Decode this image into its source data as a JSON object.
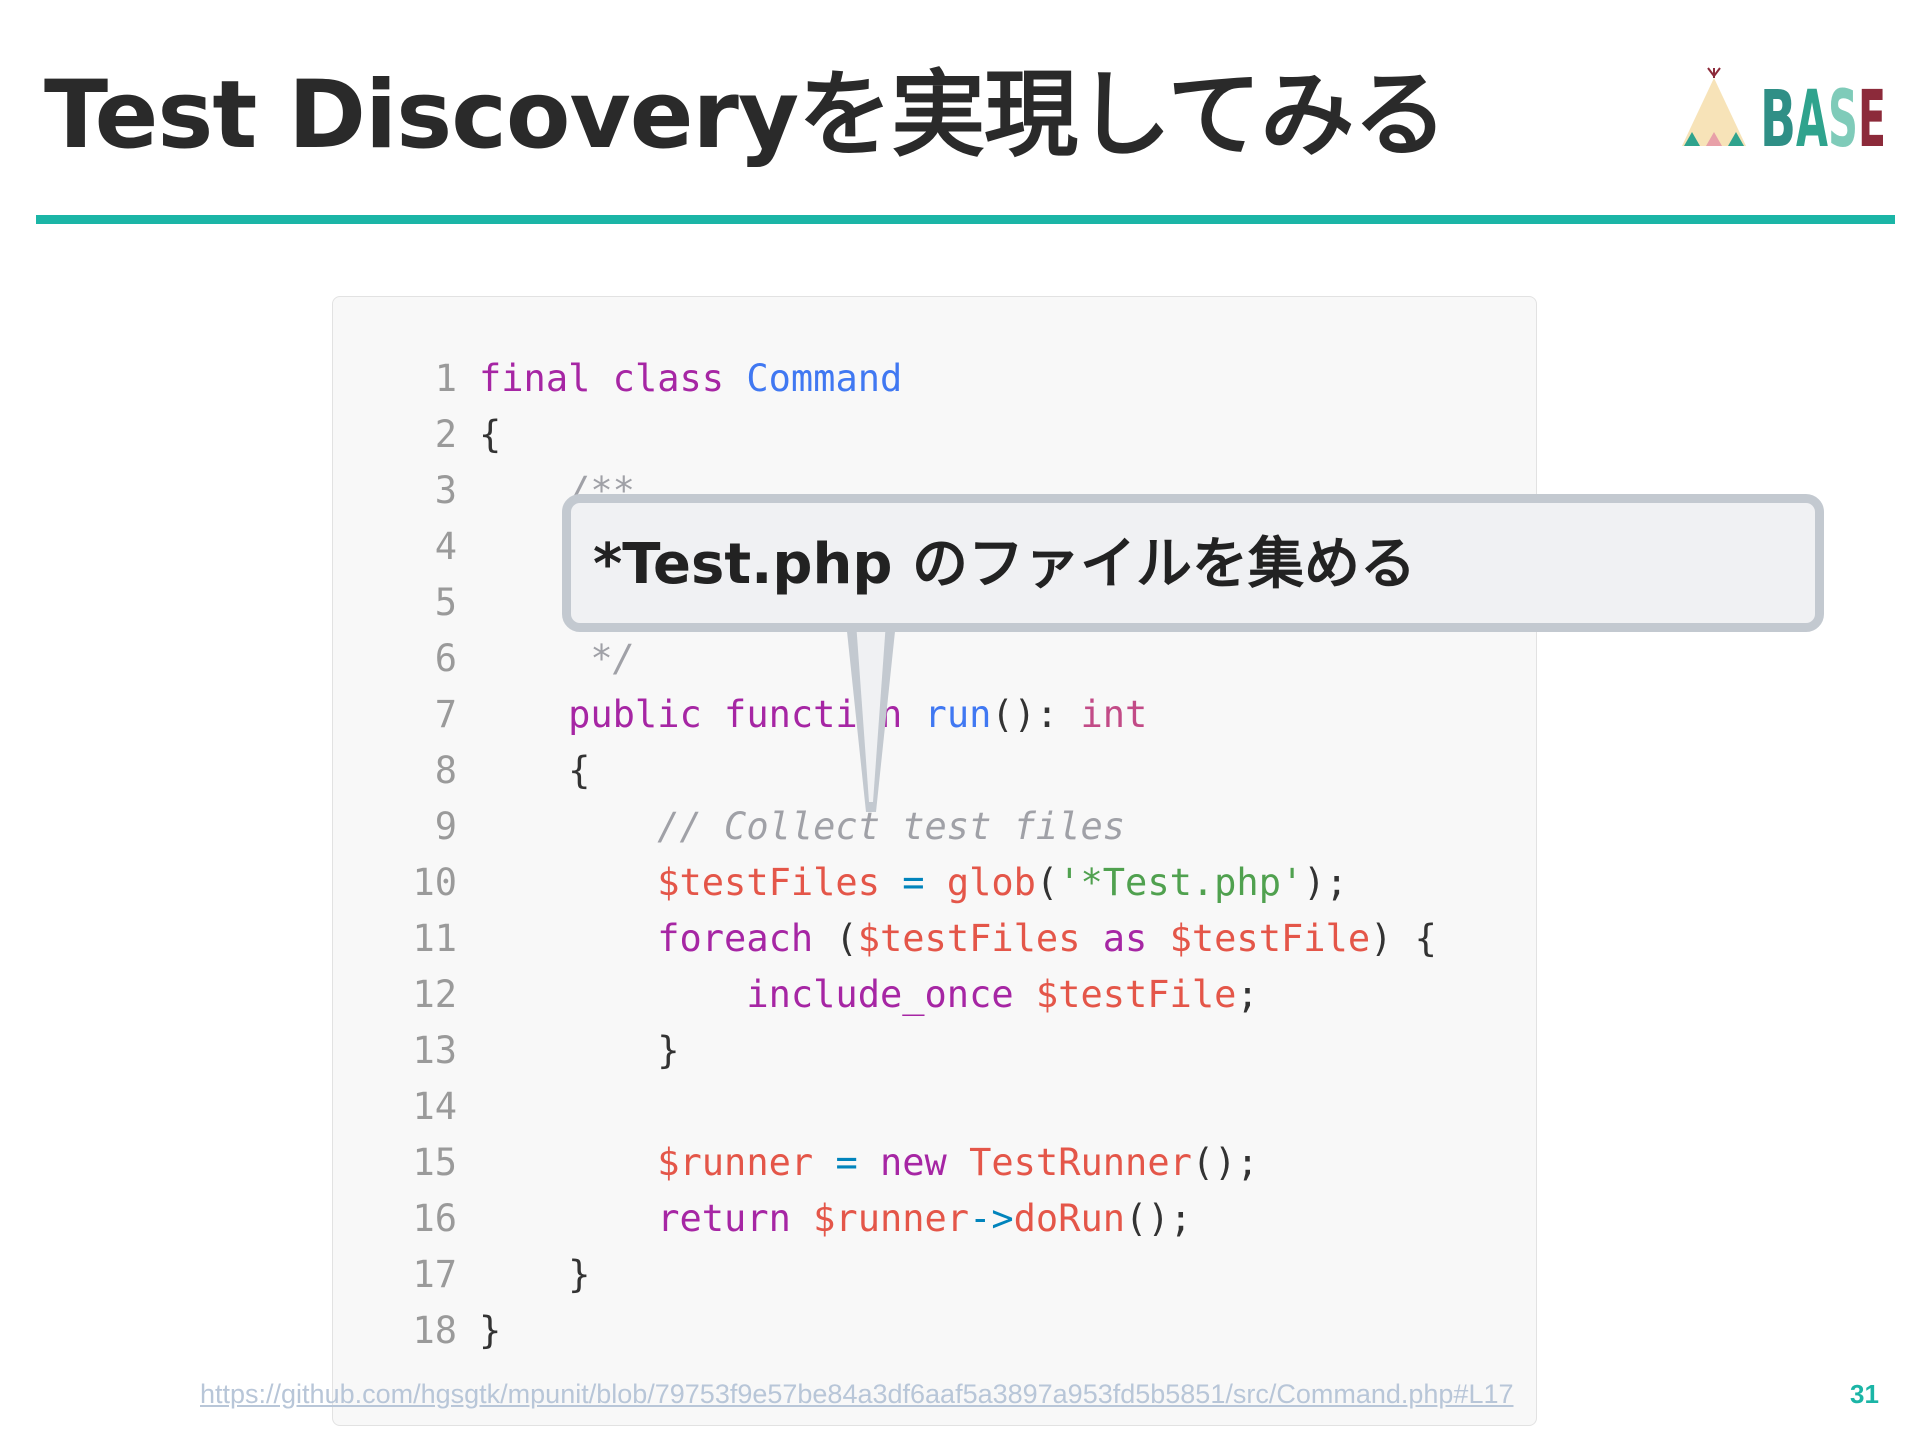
{
  "slide": {
    "title": "Test Discoveryを実現してみる",
    "logo_text": "BASE",
    "accent_color": "#1bb5a6",
    "page_number": "31",
    "source_link": "https://github.com/hgsgtk/mpunit/blob/79753f9e57be84a3df6aaf5a3897a953fd5b5851/src/Command.php#L17"
  },
  "callout": {
    "text": "*Test.php のファイルを集める"
  },
  "code": {
    "language": "php",
    "line_numbers": [
      "1",
      "2",
      "3",
      "4",
      "5",
      "6",
      "7",
      "8",
      "9",
      "10",
      "11",
      "12",
      "13",
      "14",
      "15",
      "16",
      "17",
      "18"
    ],
    "lines": [
      [
        {
          "t": "final",
          "c": "keyword"
        },
        {
          "t": " "
        },
        {
          "t": "class",
          "c": "keyword"
        },
        {
          "t": " "
        },
        {
          "t": "Command",
          "c": "class"
        }
      ],
      [
        {
          "t": "{"
        }
      ],
      [
        {
          "t": "    "
        },
        {
          "t": "/**",
          "c": "comment"
        }
      ],
      [
        {
          "t": ""
        }
      ],
      [
        {
          "t": ""
        }
      ],
      [
        {
          "t": "     "
        },
        {
          "t": "*/",
          "c": "comment"
        }
      ],
      [
        {
          "t": "    "
        },
        {
          "t": "public",
          "c": "keyword"
        },
        {
          "t": " "
        },
        {
          "t": "function",
          "c": "keyword"
        },
        {
          "t": " "
        },
        {
          "t": "run",
          "c": "func"
        },
        {
          "t": "(): "
        },
        {
          "t": "int",
          "c": "type"
        }
      ],
      [
        {
          "t": "    {"
        }
      ],
      [
        {
          "t": "        "
        },
        {
          "t": "// Collect test files",
          "c": "comment"
        }
      ],
      [
        {
          "t": "        "
        },
        {
          "t": "$testFiles",
          "c": "var"
        },
        {
          "t": " "
        },
        {
          "t": "=",
          "c": "op"
        },
        {
          "t": " "
        },
        {
          "t": "glob",
          "c": "call"
        },
        {
          "t": "("
        },
        {
          "t": "'*Test.php'",
          "c": "string"
        },
        {
          "t": ");"
        }
      ],
      [
        {
          "t": "        "
        },
        {
          "t": "foreach",
          "c": "keyword"
        },
        {
          "t": " ("
        },
        {
          "t": "$testFiles",
          "c": "var"
        },
        {
          "t": " "
        },
        {
          "t": "as",
          "c": "keyword"
        },
        {
          "t": " "
        },
        {
          "t": "$testFile",
          "c": "var"
        },
        {
          "t": ") {"
        }
      ],
      [
        {
          "t": "            "
        },
        {
          "t": "include_once",
          "c": "keyword"
        },
        {
          "t": " "
        },
        {
          "t": "$testFile",
          "c": "var"
        },
        {
          "t": ";"
        }
      ],
      [
        {
          "t": "        }"
        }
      ],
      [
        {
          "t": ""
        }
      ],
      [
        {
          "t": "        "
        },
        {
          "t": "$runner",
          "c": "var"
        },
        {
          "t": " "
        },
        {
          "t": "=",
          "c": "op"
        },
        {
          "t": " "
        },
        {
          "t": "new",
          "c": "keyword"
        },
        {
          "t": " "
        },
        {
          "t": "TestRunner",
          "c": "call"
        },
        {
          "t": "();"
        }
      ],
      [
        {
          "t": "        "
        },
        {
          "t": "return",
          "c": "keyword"
        },
        {
          "t": " "
        },
        {
          "t": "$runner",
          "c": "var"
        },
        {
          "t": "->",
          "c": "op"
        },
        {
          "t": "doRun",
          "c": "call"
        },
        {
          "t": "();"
        }
      ],
      [
        {
          "t": "    }"
        }
      ],
      [
        {
          "t": "}"
        }
      ]
    ]
  }
}
